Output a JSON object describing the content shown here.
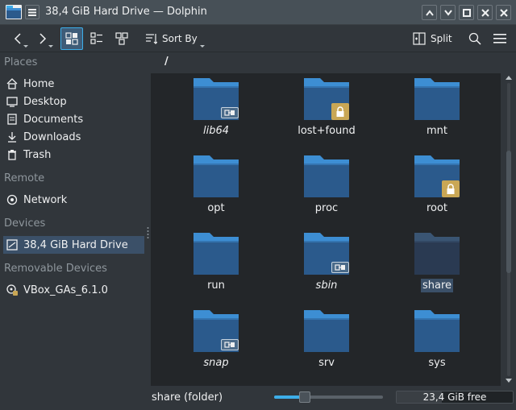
{
  "window": {
    "title": "38,4 GiB Hard Drive — Dolphin"
  },
  "toolbar": {
    "sort_label": "Sort By",
    "split_label": "Split"
  },
  "sidebar": {
    "sections": [
      {
        "title": "Places",
        "items": [
          {
            "label": "Home",
            "icon": "home-icon"
          },
          {
            "label": "Desktop",
            "icon": "desktop-icon"
          },
          {
            "label": "Documents",
            "icon": "documents-icon"
          },
          {
            "label": "Downloads",
            "icon": "downloads-icon"
          },
          {
            "label": "Trash",
            "icon": "trash-icon"
          }
        ]
      },
      {
        "title": "Remote",
        "items": [
          {
            "label": "Network",
            "icon": "network-icon"
          }
        ]
      },
      {
        "title": "Devices",
        "items": [
          {
            "label": "38,4 GiB Hard Drive",
            "icon": "hard-drive-icon",
            "selected": true
          }
        ]
      },
      {
        "title": "Removable Devices",
        "items": [
          {
            "label": "VBox_GAs_6.1.0",
            "icon": "optical-disc-icon"
          }
        ]
      }
    ]
  },
  "location": {
    "path": "/"
  },
  "files": [
    {
      "name": "lib64",
      "symlink": true,
      "locked": false,
      "italic": true
    },
    {
      "name": "lost+found",
      "symlink": false,
      "locked": true,
      "italic": false
    },
    {
      "name": "mnt",
      "symlink": false,
      "locked": false,
      "italic": false
    },
    {
      "name": "opt",
      "symlink": false,
      "locked": false,
      "italic": false
    },
    {
      "name": "proc",
      "symlink": false,
      "locked": false,
      "italic": false
    },
    {
      "name": "root",
      "symlink": false,
      "locked": true,
      "italic": false
    },
    {
      "name": "run",
      "symlink": false,
      "locked": false,
      "italic": false
    },
    {
      "name": "sbin",
      "symlink": true,
      "locked": false,
      "italic": true
    },
    {
      "name": "share",
      "symlink": false,
      "locked": false,
      "italic": false,
      "selected": true
    },
    {
      "name": "snap",
      "symlink": true,
      "locked": false,
      "italic": true
    },
    {
      "name": "srv",
      "symlink": false,
      "locked": false,
      "italic": false
    },
    {
      "name": "sys",
      "symlink": false,
      "locked": false,
      "italic": false
    }
  ],
  "status": {
    "selection_text": "share (folder)",
    "zoom_level": 0.28,
    "free_space_text": "23,4 GiB free",
    "used_fraction": 0.39
  },
  "colors": {
    "accent": "#3daee9",
    "folder": "#2b5a8c",
    "folder_tab": "#3d8ed3",
    "selection": "#3b5068"
  }
}
